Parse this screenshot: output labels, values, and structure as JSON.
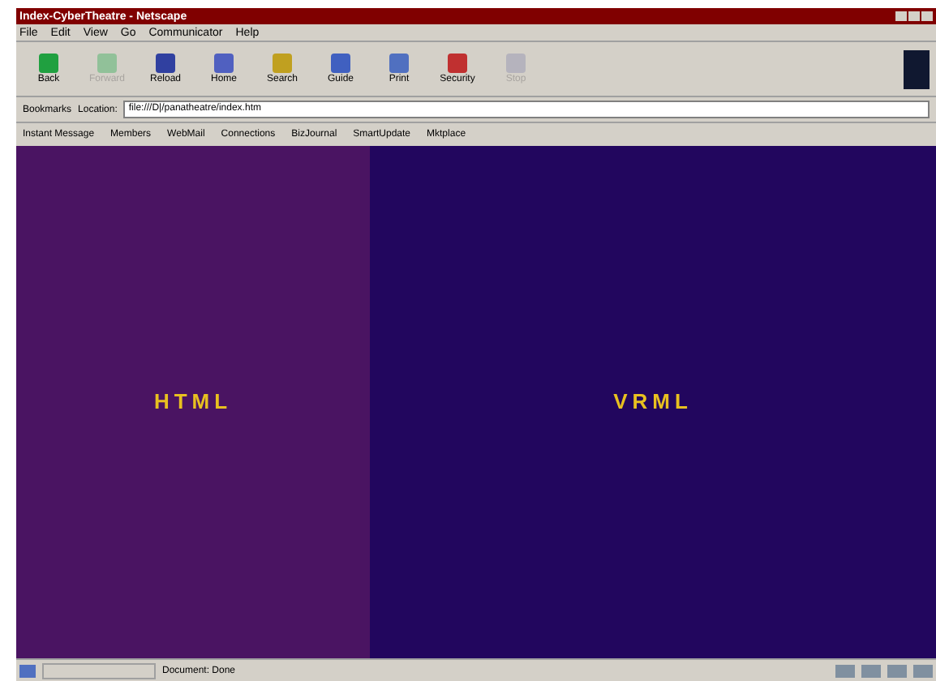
{
  "window": {
    "title": "Index-CyberTheatre - Netscape"
  },
  "menu": [
    "File",
    "Edit",
    "View",
    "Go",
    "Communicator",
    "Help"
  ],
  "toolbar": [
    {
      "label": "Back",
      "disabled": false
    },
    {
      "label": "Forward",
      "disabled": true
    },
    {
      "label": "Reload",
      "disabled": false
    },
    {
      "label": "Home",
      "disabled": false
    },
    {
      "label": "Search",
      "disabled": false
    },
    {
      "label": "Guide",
      "disabled": false
    },
    {
      "label": "Print",
      "disabled": false
    },
    {
      "label": "Security",
      "disabled": false
    },
    {
      "label": "Stop",
      "disabled": true
    }
  ],
  "location_bar": {
    "bookmarks": "Bookmarks",
    "label": "Location:",
    "value": "file:///D|/panatheatre/index.htm"
  },
  "personal_bar": [
    "Instant Message",
    "Members",
    "WebMail",
    "Connections",
    "BizJournal",
    "SmartUpdate",
    "Mktplace"
  ],
  "frames": [
    {
      "label": "HTML",
      "color": "#4a1462"
    },
    {
      "label": "VRML",
      "color": "#22065e"
    }
  ],
  "status_bar": {
    "text": "Document: Done"
  }
}
